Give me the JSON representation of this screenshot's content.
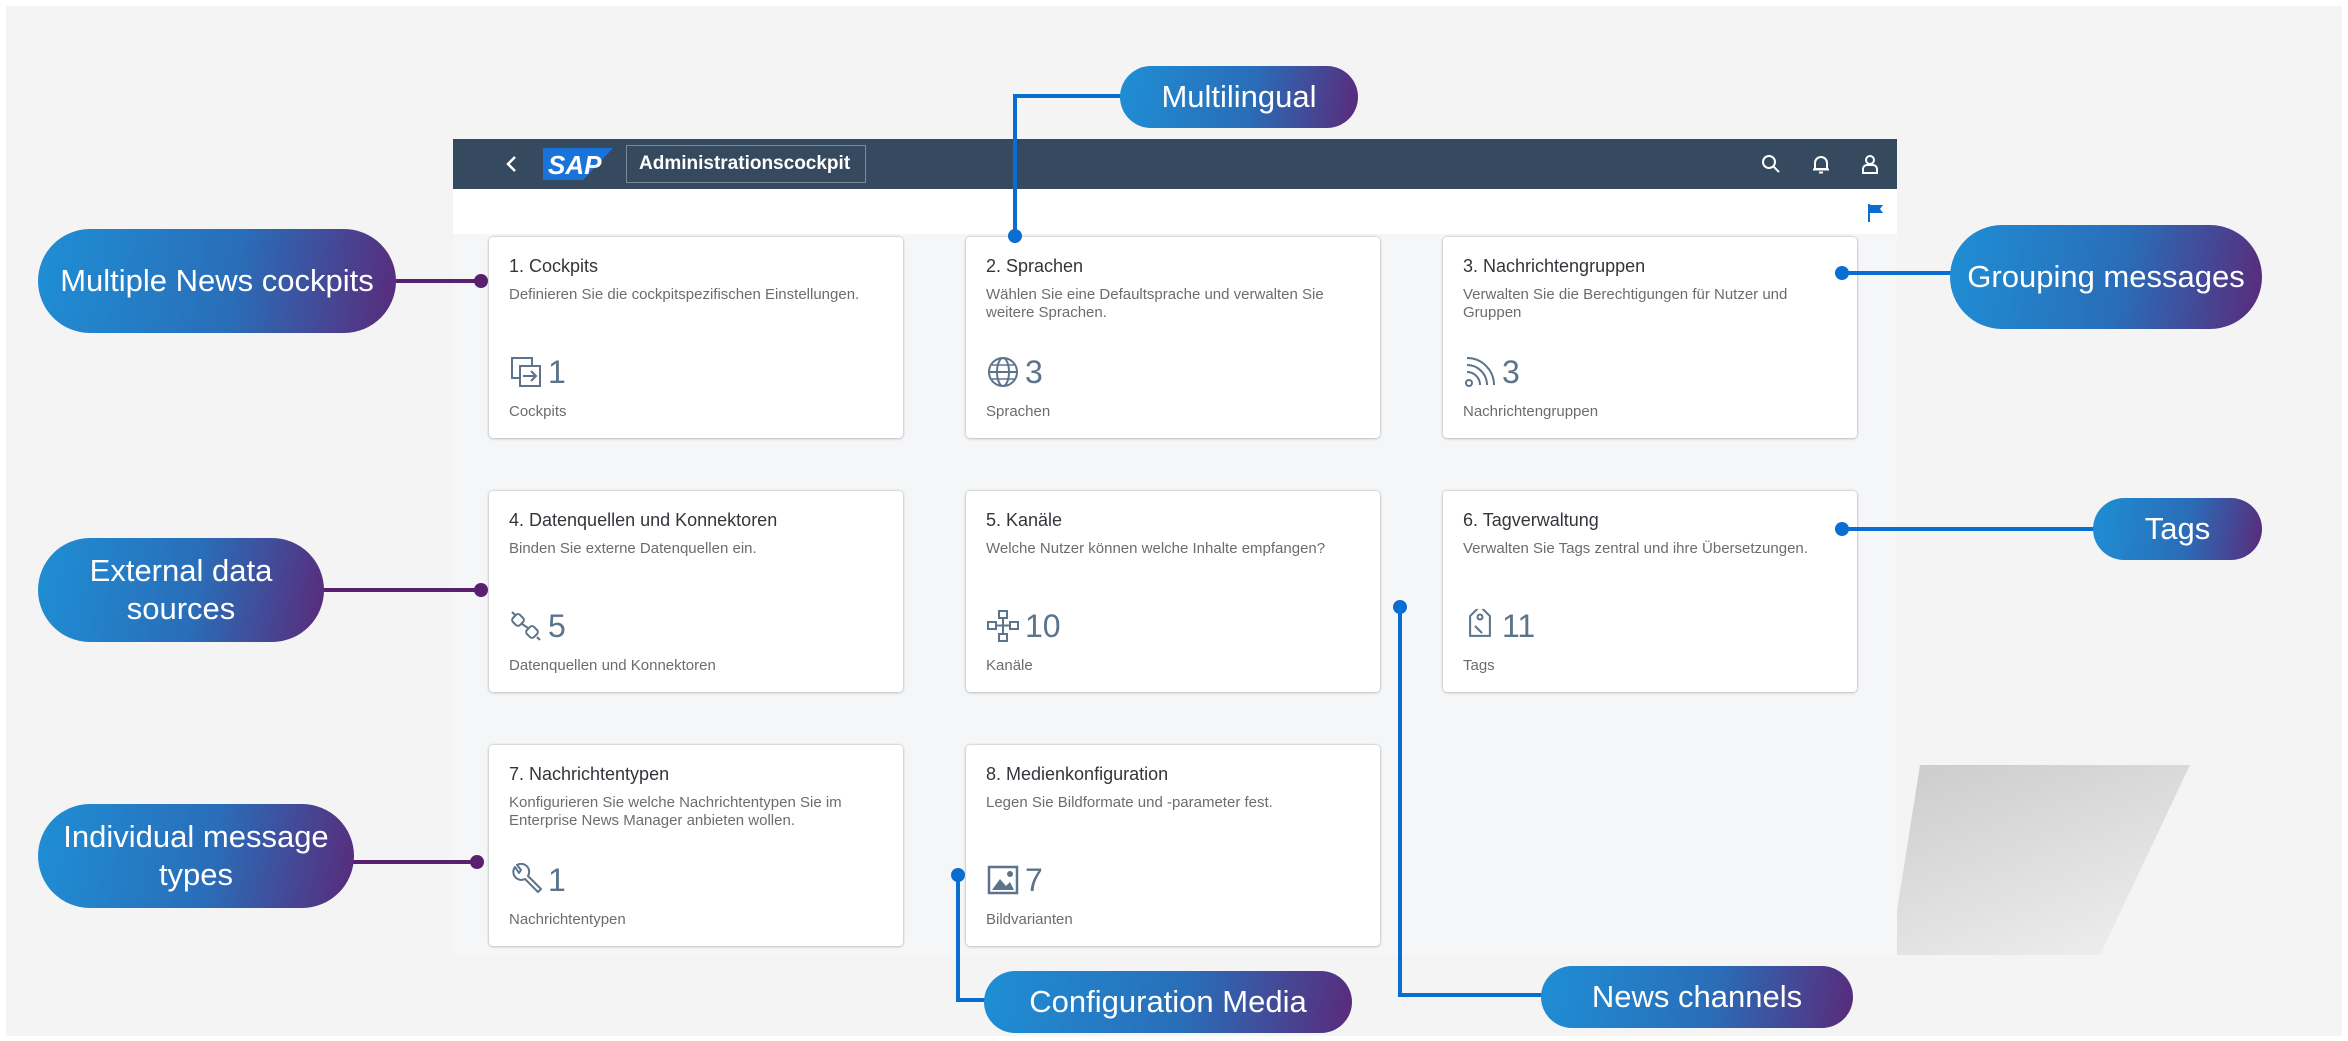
{
  "shell": {
    "back_icon": "chevron-left-icon",
    "logo_text": "SAP",
    "app_title": "Administrationscockpit",
    "icons": [
      "search-icon",
      "bell-icon",
      "user-icon"
    ],
    "brand_color": "#354a5f",
    "logo_color": "#1a73d9"
  },
  "subheader": {
    "flag_icon": "flag-icon",
    "flag_color": "#0a6ed1"
  },
  "tiles": [
    {
      "title": "1. Cockpits",
      "subtitle": "Definieren Sie die cockpitspezifischen Einstellungen.",
      "icon": "transfer-icon",
      "value": "1",
      "footer": "Cockpits"
    },
    {
      "title": "2. Sprachen",
      "subtitle": "Wählen Sie eine Defaultsprache und verwalten Sie weitere Sprachen.",
      "icon": "globe-icon",
      "value": "3",
      "footer": "Sprachen"
    },
    {
      "title": "3. Nachrichtengruppen",
      "subtitle": "Verwalten Sie die Berechtigungen für Nutzer und Gruppen",
      "icon": "feed-icon",
      "value": "3",
      "footer": "Nachrichtengruppen"
    },
    {
      "title": "4. Datenquellen und Konnektoren",
      "subtitle": "Binden Sie externe Datenquellen ein.",
      "icon": "connector-icon",
      "value": "5",
      "footer": "Datenquellen und Konnektoren"
    },
    {
      "title": "5. Kanäle",
      "subtitle": "Welche Nutzer können welche Inhalte empfangen?",
      "icon": "network-icon",
      "value": "10",
      "footer": "Kanäle"
    },
    {
      "title": "6. Tagverwaltung",
      "subtitle": "Verwalten Sie Tags zentral und ihre Übersetzungen.",
      "icon": "tag-icon",
      "value": "11",
      "footer": "Tags"
    },
    {
      "title": "7. Nachrichtentypen",
      "subtitle": "Konfigurieren Sie welche Nachrichtentypen Sie im Enterprise News Manager anbieten wollen.",
      "icon": "wrench-icon",
      "value": "1",
      "footer": "Nachrichtentypen"
    },
    {
      "title": "8. Medienkonfiguration",
      "subtitle": "Legen Sie Bildformate und -parameter fest.",
      "icon": "image-icon",
      "value": "7",
      "footer": "Bildvarianten"
    }
  ],
  "callouts": {
    "multilingual": "Multilingual",
    "multiple_news_cockpits": "Multiple News cockpits",
    "grouping_messages": "Grouping messages",
    "external_data_sources": "External data sources",
    "tags": "Tags",
    "individual_message_types": "Individual message types",
    "configuration_media": "Configuration Media",
    "news_channels": "News channels"
  },
  "colors": {
    "callout_gradient": [
      "#1e8fd5",
      "#2a6db8",
      "#5a2a7a"
    ],
    "connector_blue": "#0a6ed1",
    "connector_purple": "#5a2070",
    "kpi_color": "#5b738b"
  }
}
